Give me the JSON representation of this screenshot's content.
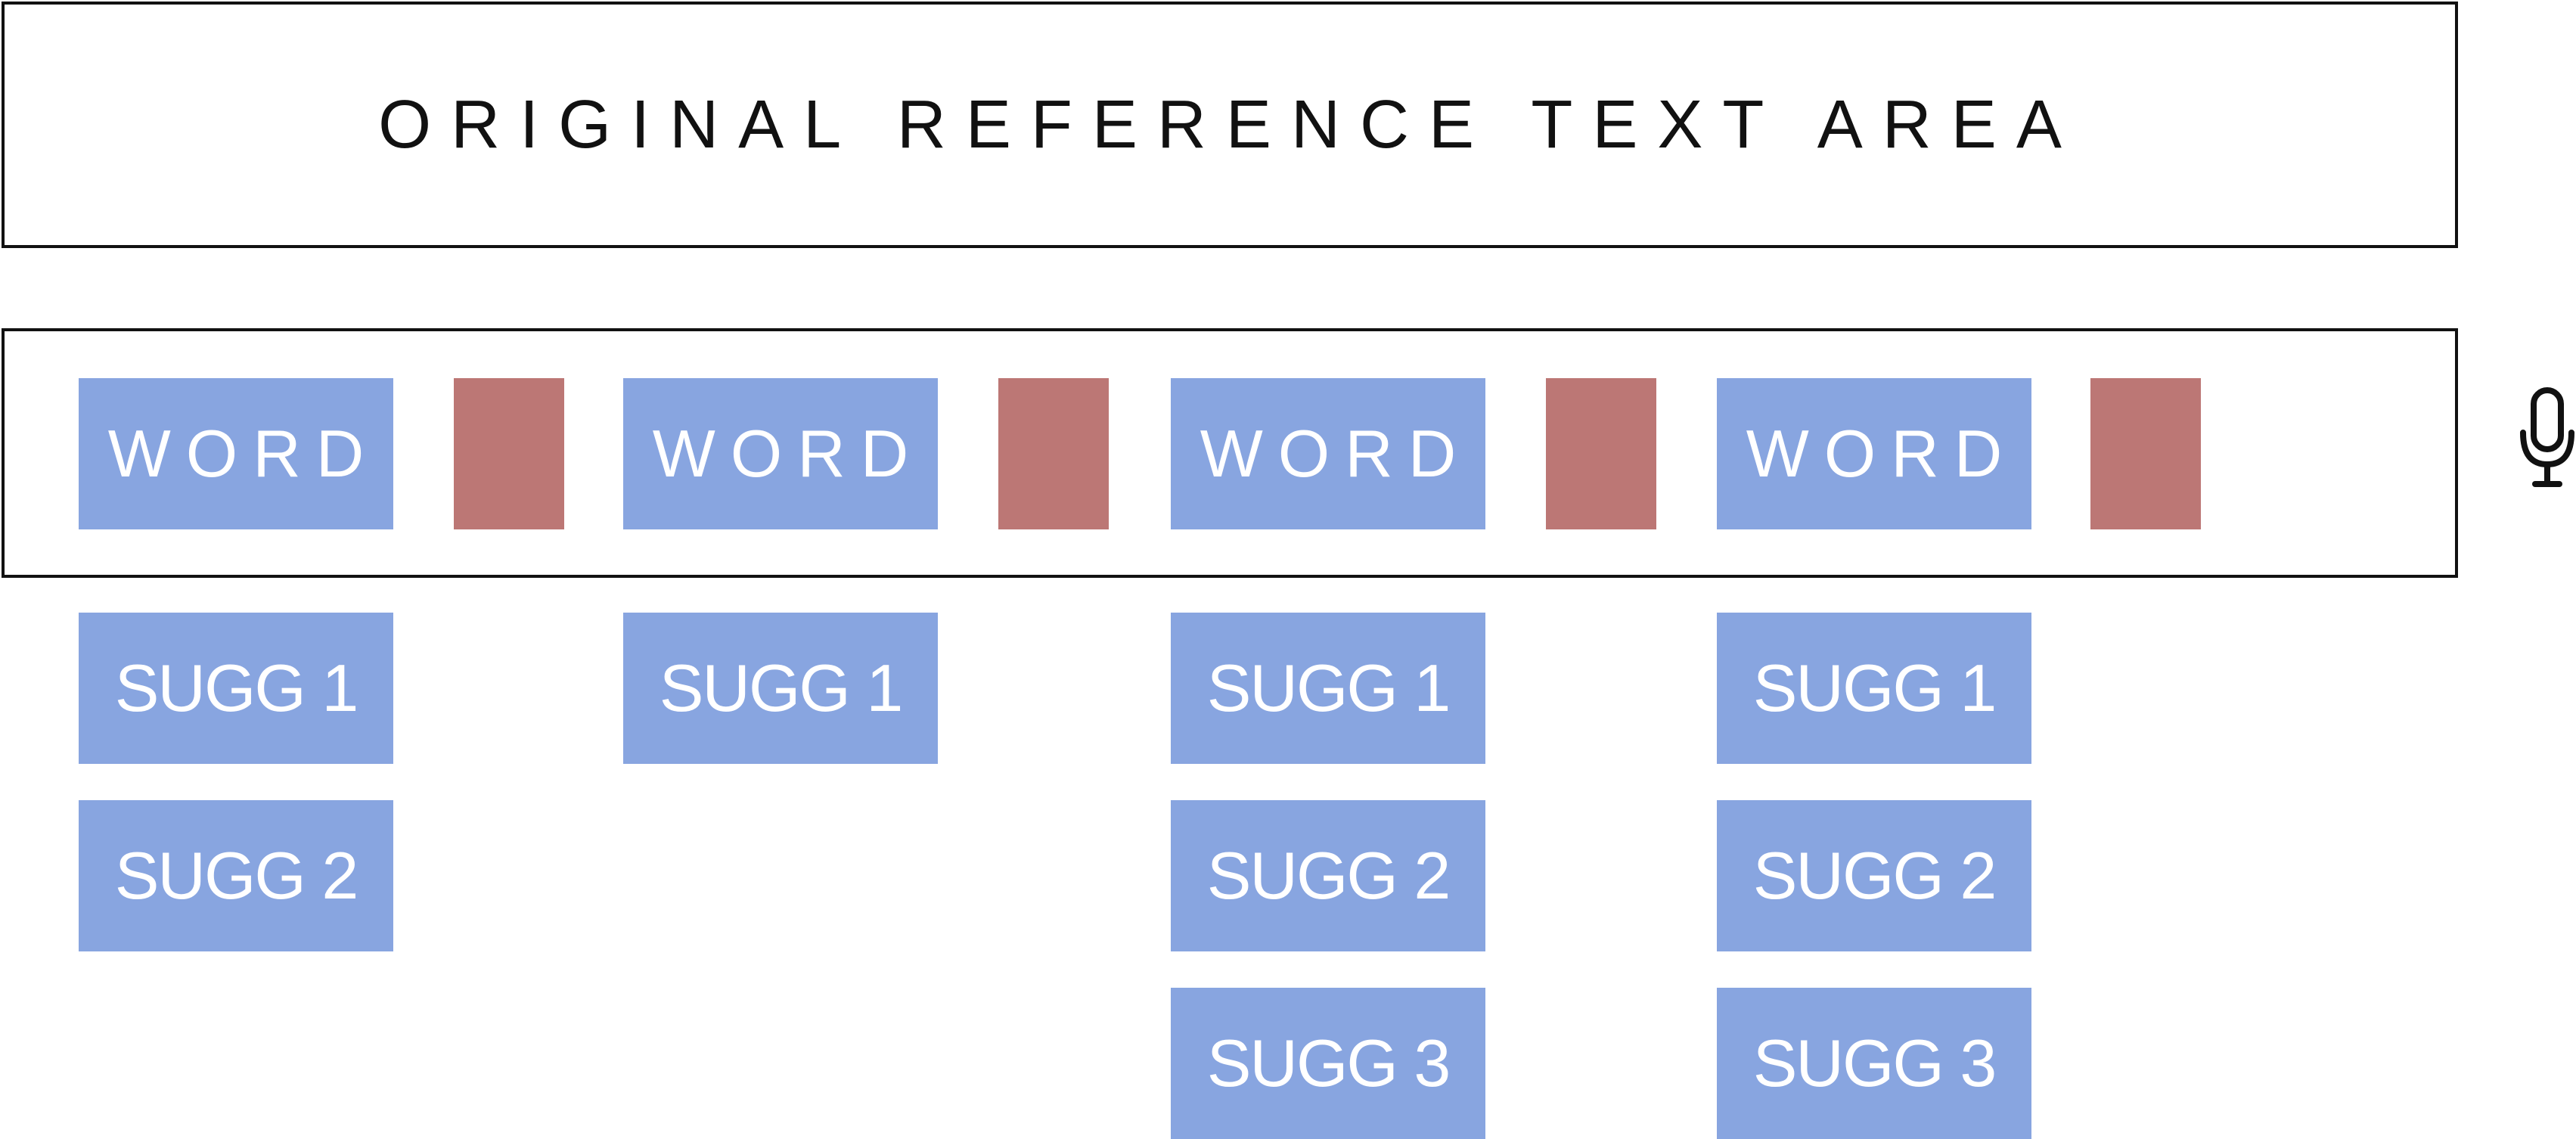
{
  "reference": {
    "text": "ORIGINAL REFERENCE TEXT AREA"
  },
  "colors": {
    "tile": "#88a5e0",
    "gap": "#bc7775",
    "border": "#111111",
    "text_on_tile": "#ffffff"
  },
  "words": [
    {
      "label": "WORD",
      "suggestions": [
        "SUGG 1",
        "SUGG 2"
      ]
    },
    {
      "label": "WORD",
      "suggestions": [
        "SUGG 1"
      ]
    },
    {
      "label": "WORD",
      "suggestions": [
        "SUGG 1",
        "SUGG 2",
        "SUGG 3"
      ]
    },
    {
      "label": "WORD",
      "suggestions": [
        "SUGG 1",
        "SUGG 2",
        "SUGG 3"
      ]
    }
  ],
  "icons": {
    "microphone": "microphone-icon"
  }
}
